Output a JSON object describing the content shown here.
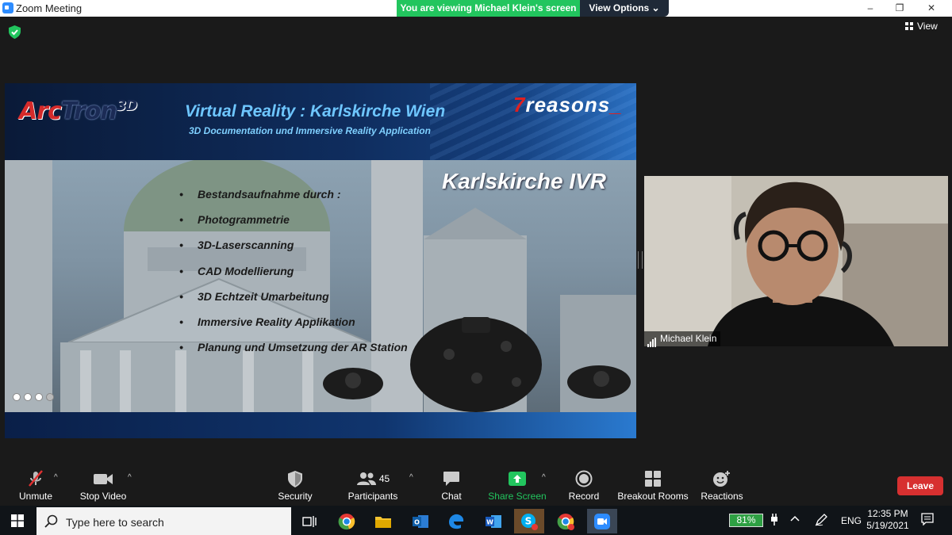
{
  "window": {
    "title": "Zoom Meeting",
    "minimize": "–",
    "restore": "❐",
    "close": "✕"
  },
  "share_banner": {
    "text": "You are viewing Michael Klein's screen",
    "view_options": "View Options ⌄"
  },
  "view_button": "View",
  "slide": {
    "logo_arc": "Arc",
    "logo_tron": "Tron",
    "logo_3d": "3D",
    "title": "Virtual Reality : Karlskirche Wien",
    "subtitle": "3D Documentation und Immersive Reality Application",
    "partner_seven": "7",
    "partner_text": "reasons",
    "partner_dash": "_",
    "heading": "Karlskirche IVR",
    "bullets": [
      "Bestandsaufnahme durch :",
      "Photogrammetrie",
      "3D-Laserscanning",
      "CAD Modellierung",
      "3D Echtzeit Umarbeitung",
      "Immersive Reality Applikation",
      "Planung und Umsetzung der AR Station"
    ]
  },
  "participant": {
    "name": "Michael Klein"
  },
  "toolbar": {
    "unmute": "Unmute",
    "stop_video": "Stop Video",
    "security": "Security",
    "participants": "Participants",
    "participants_count": "45",
    "chat": "Chat",
    "share_screen": "Share Screen",
    "record": "Record",
    "breakout_rooms": "Breakout Rooms",
    "reactions": "Reactions",
    "leave": "Leave"
  },
  "taskbar": {
    "search_placeholder": "Type here to search",
    "battery": "81%",
    "language": "ENG",
    "time": "12:35 PM",
    "date": "5/19/2021"
  },
  "colors": {
    "share_green": "#22c55e",
    "leave_red": "#d73030",
    "zoom_blue": "#2d8cff"
  }
}
